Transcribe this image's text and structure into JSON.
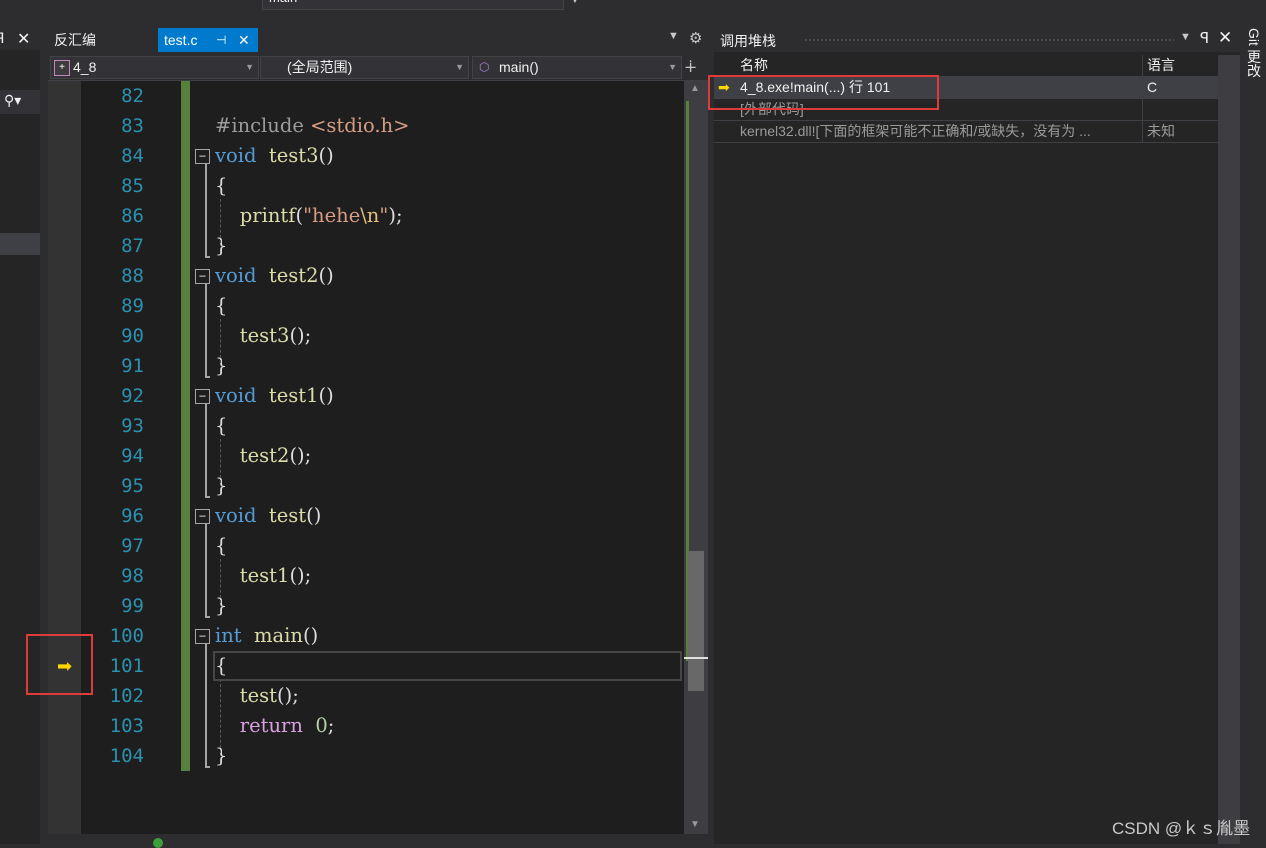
{
  "top": {
    "combo_value": "main"
  },
  "tabs": {
    "disasm": "反汇编",
    "testc": "test.c",
    "pin": "⊣",
    "close": "✕"
  },
  "nav": {
    "project": "4_8",
    "scope": "(全局范围)",
    "function": "main()"
  },
  "editor": {
    "lines": [
      {
        "n": "82",
        "seg": []
      },
      {
        "n": "83",
        "seg": [
          [
            "pre",
            "#include "
          ],
          [
            "str",
            "<stdio.h>"
          ]
        ]
      },
      {
        "n": "84",
        "seg": [
          [
            "kw",
            "void"
          ],
          [
            "",
            "  "
          ],
          [
            "fn",
            "test3"
          ],
          [
            "",
            "()"
          ]
        ]
      },
      {
        "n": "85",
        "seg": [
          [
            "",
            "{"
          ]
        ]
      },
      {
        "n": "86",
        "seg": [
          [
            "",
            "    "
          ],
          [
            "fn",
            "printf"
          ],
          [
            "",
            "("
          ],
          [
            "str",
            "\"hehe"
          ],
          [
            "esc",
            "\\n"
          ],
          [
            "str",
            "\""
          ],
          [
            "",
            ");"
          ]
        ]
      },
      {
        "n": "87",
        "seg": [
          [
            "",
            "}"
          ]
        ]
      },
      {
        "n": "88",
        "seg": [
          [
            "kw",
            "void"
          ],
          [
            "",
            "  "
          ],
          [
            "fn",
            "test2"
          ],
          [
            "",
            "()"
          ]
        ]
      },
      {
        "n": "89",
        "seg": [
          [
            "",
            "{"
          ]
        ]
      },
      {
        "n": "90",
        "seg": [
          [
            "",
            "    "
          ],
          [
            "fn",
            "test3"
          ],
          [
            "",
            "();"
          ]
        ]
      },
      {
        "n": "91",
        "seg": [
          [
            "",
            "}"
          ]
        ]
      },
      {
        "n": "92",
        "seg": [
          [
            "kw",
            "void"
          ],
          [
            "",
            "  "
          ],
          [
            "fn",
            "test1"
          ],
          [
            "",
            "()"
          ]
        ]
      },
      {
        "n": "93",
        "seg": [
          [
            "",
            "{"
          ]
        ]
      },
      {
        "n": "94",
        "seg": [
          [
            "",
            "    "
          ],
          [
            "fn",
            "test2"
          ],
          [
            "",
            "();"
          ]
        ]
      },
      {
        "n": "95",
        "seg": [
          [
            "",
            "}"
          ]
        ]
      },
      {
        "n": "96",
        "seg": [
          [
            "kw",
            "void"
          ],
          [
            "",
            "  "
          ],
          [
            "fn",
            "test"
          ],
          [
            "",
            "()"
          ]
        ]
      },
      {
        "n": "97",
        "seg": [
          [
            "",
            "{"
          ]
        ]
      },
      {
        "n": "98",
        "seg": [
          [
            "",
            "    "
          ],
          [
            "fn",
            "test1"
          ],
          [
            "",
            "();"
          ]
        ]
      },
      {
        "n": "99",
        "seg": [
          [
            "",
            "}"
          ]
        ]
      },
      {
        "n": "100",
        "seg": [
          [
            "kw",
            "int"
          ],
          [
            "",
            "  "
          ],
          [
            "fn",
            "main"
          ],
          [
            "",
            "()"
          ]
        ]
      },
      {
        "n": "101",
        "seg": [
          [
            "",
            "{"
          ]
        ]
      },
      {
        "n": "102",
        "seg": [
          [
            "",
            "    "
          ],
          [
            "fn",
            "test"
          ],
          [
            "",
            "();"
          ]
        ]
      },
      {
        "n": "103",
        "seg": [
          [
            "",
            "    "
          ],
          [
            "ret",
            "return"
          ],
          [
            "",
            "  "
          ],
          [
            "num",
            "0"
          ],
          [
            "",
            ";"
          ]
        ]
      },
      {
        "n": "104",
        "seg": [
          [
            "",
            "}"
          ]
        ]
      }
    ]
  },
  "callstack": {
    "title": "调用堆栈",
    "columns": {
      "name": "名称",
      "language": "语言"
    },
    "rows": [
      {
        "name": "4_8.exe!main(...) 行 101",
        "language": "C",
        "current": true
      },
      {
        "name": "[外部代码]",
        "language": "",
        "current": false
      },
      {
        "name": "kernel32.dll![下面的框架可能不正确和/或缺失，没有为 ...",
        "language": "未知",
        "current": false
      }
    ]
  },
  "rightrail": {
    "label": "Git 更改"
  },
  "watermark": "CSDN @ｋｓ胤墨",
  "colors": {
    "accent": "#007acc",
    "highlight_box": "#e03b3b",
    "ip_arrow": "#ffd700",
    "change_bar": "#57803c"
  }
}
